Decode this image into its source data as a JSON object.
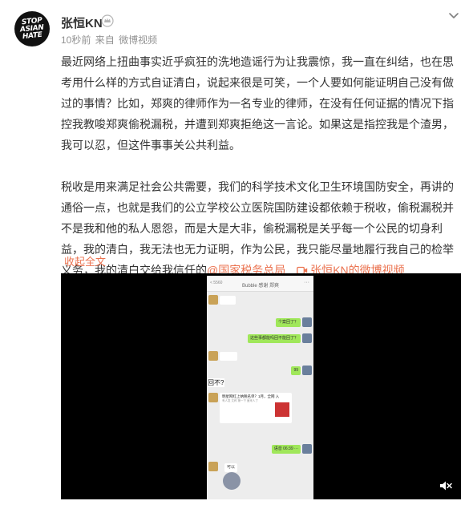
{
  "post": {
    "avatar_text": [
      "STOP",
      "ASIAN",
      "HATE"
    ],
    "username": "张恒KN",
    "time": "10秒前",
    "source_prefix": "来自",
    "source": "微博视频",
    "paragraphs": [
      "最近网络上扭曲事实近乎疯狂的洗地造谣行为让我震惊，我一直在纠结，也在思考用什么样的方式自证清白，说起来很是可笑，一个人要如何能证明自己没有做过的事情？比如，郑爽的律师作为一名专业的律师，在没有任何证据的情况下指控我教唆郑爽偷税漏税，并遭到郑爽拒绝这一言论。如果这是指控我是个渣男，我可以忍，但这件事事关公共利益。",
      "税收是用来满足社会公共需要，我们的科学技术文化卫生环境国防安全，再讲的通俗一点，也就是我们的公立学校公立医院国防建设都依赖于税收，偷税漏税并不是我和他的私人恩怨，而是大是大非，偷税漏税是关乎每一个公民的切身利益，我的清白，我无法也无力证明，作为公民，我只能尽量地履行我自己的检举义务，我的清白交给我信任的"
    ],
    "mention": "@国家税务总局",
    "video_link": "张恒KN的微博视频",
    "collapse_label": "收起全文"
  },
  "video": {
    "chat_title": "Bubble 感谢 郑爽",
    "back_label": "< 5560",
    "more_label": "···",
    "overlay_text": "回不?",
    "card_line1": "明星网红上纳税名单？1月，全网 入",
    "card_line2": "有人发  文称 第一下 面来人了",
    "bubble_right_1": "个案回了？",
    "bubble_right_2": "这些事都能吗回不能回了？",
    "bubble_right_3": "99",
    "bubble_right_4": "语音 06:39 ···",
    "sticker_text": "可以"
  },
  "icons": {
    "badge": "crown-badge-icon",
    "chevron": "chevron-down-icon",
    "video_link": "video-camera-icon",
    "mute": "mute-speaker-icon"
  },
  "colors": {
    "link": "#eb7350",
    "text": "#333333",
    "meta": "#939393",
    "video_bg": "#000000",
    "chat_bubble": "#a0e75a"
  }
}
